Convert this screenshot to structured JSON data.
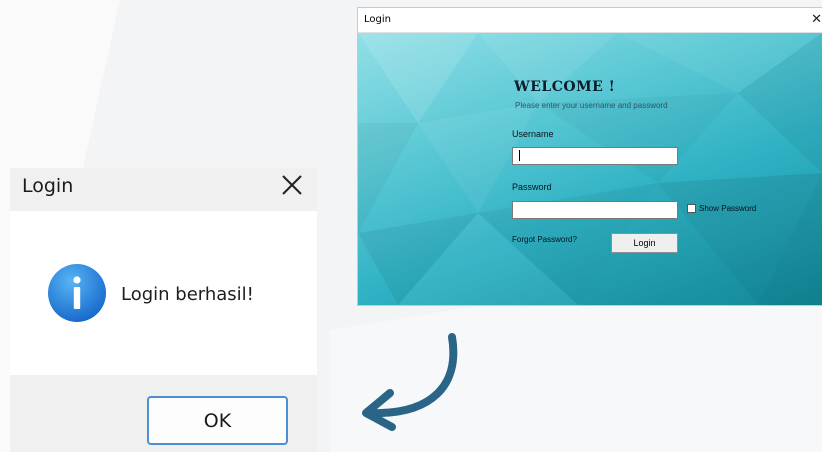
{
  "colors": {
    "accent_blue": "#4c8fd6",
    "arrow": "#2a6486",
    "teal_dark": "#128e9f",
    "teal_light": "#92dfe6",
    "info_icon": "#1e82dc"
  },
  "login_window": {
    "title": "Login",
    "close_glyph": "✕",
    "welcome": "WELCOME !",
    "subtitle": "Please enter your username and password",
    "username_label": "Username",
    "username_value": "",
    "password_label": "Password",
    "password_value": "",
    "show_password_label": "Show Password",
    "show_password_checked": false,
    "forgot_password": "Forgot Password?",
    "login_button": "Login"
  },
  "message_box": {
    "title": "Login",
    "icon": "info-icon",
    "message": "Login berhasil!",
    "ok_button": "OK"
  }
}
